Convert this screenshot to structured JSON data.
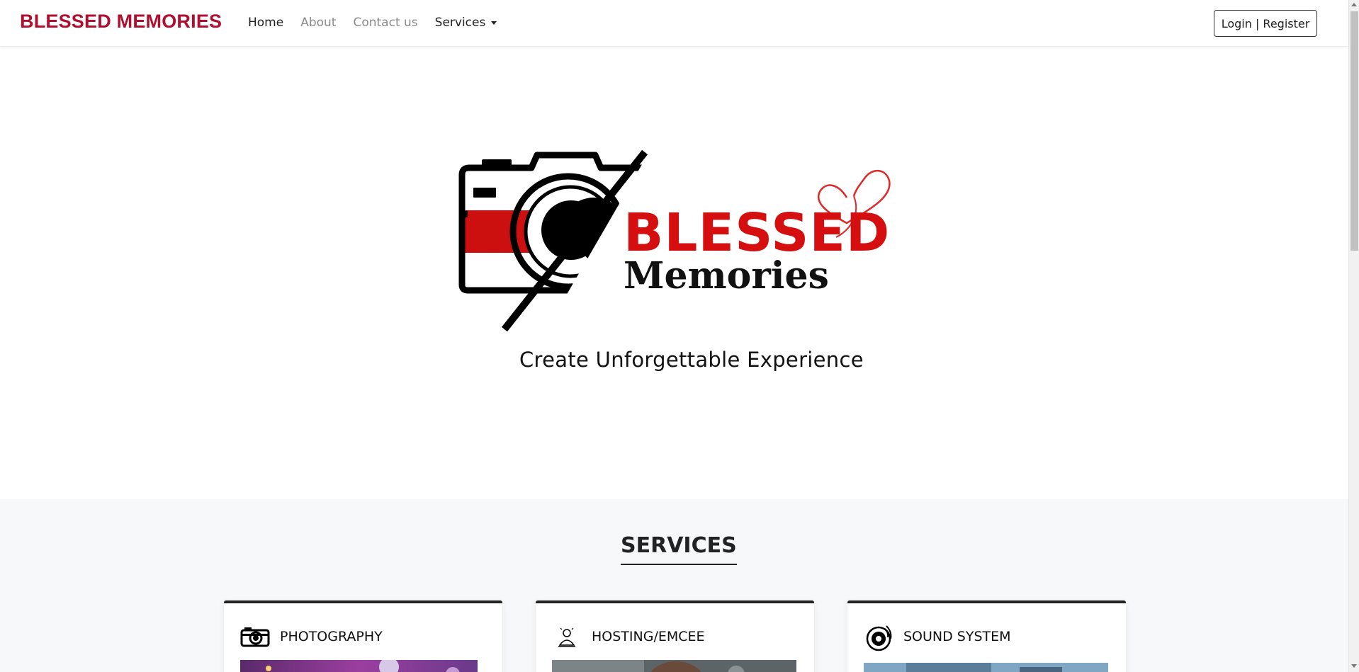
{
  "brand": "BLESSED MEMORIES",
  "nav": {
    "items": [
      {
        "label": "Home",
        "state": "active"
      },
      {
        "label": "About",
        "state": "muted"
      },
      {
        "label": "Contact us",
        "state": "muted"
      },
      {
        "label": "Services",
        "state": "dropdown"
      }
    ],
    "login_label": "Login | Register"
  },
  "hero": {
    "logo_word1": "BLESSED",
    "logo_word2": "Memories",
    "tagline": "Create Unforgettable Experience"
  },
  "services": {
    "title": "SERVICES",
    "cards": [
      {
        "title": "PHOTOGRAPHY",
        "icon": "camera-icon"
      },
      {
        "title": "HOSTING/EMCEE",
        "icon": "emcee-icon"
      },
      {
        "title": "SOUND SYSTEM",
        "icon": "speaker-icon"
      }
    ]
  },
  "colors": {
    "brand_red": "#b0102f",
    "logo_red": "#d50f0f",
    "heart_red": "#e02828",
    "section_bg": "#f7f8f9"
  }
}
